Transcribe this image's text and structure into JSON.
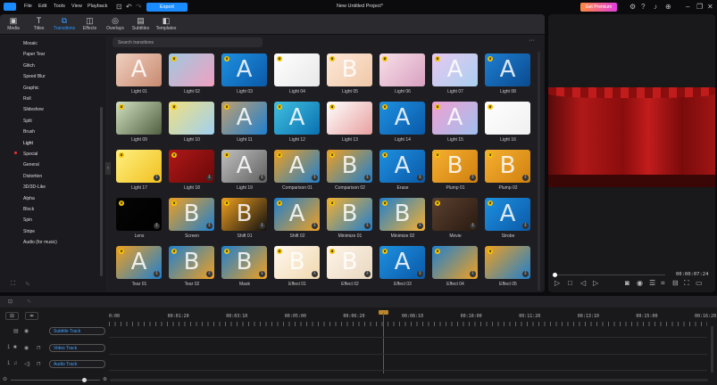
{
  "titlebar": {
    "menu": [
      "File",
      "Edit",
      "Tools",
      "View",
      "Playback"
    ],
    "export": "Export",
    "project_title": "New Untitled Project*",
    "premium": "Get Premium"
  },
  "tabs": [
    {
      "label": "Media",
      "icon": "▣"
    },
    {
      "label": "Titles",
      "icon": "T"
    },
    {
      "label": "Transitions",
      "icon": "⧉"
    },
    {
      "label": "Effects",
      "icon": "◫"
    },
    {
      "label": "Overlays",
      "icon": "◎"
    },
    {
      "label": "Subtitles",
      "icon": "▤"
    },
    {
      "label": "Templates",
      "icon": "◧"
    }
  ],
  "active_tab": "Transitions",
  "categories": [
    "Mosaic",
    "Paper Tear",
    "Glitch",
    "Speed Blur",
    "Graphic",
    "Roll",
    "Slideshow",
    "Split",
    "Brush",
    "Light",
    "Special",
    "General",
    "Distortion",
    "3D/3D-Like",
    "Alpha",
    "Block",
    "Spin",
    "Stripe",
    "Audio (for music)"
  ],
  "active_category": "Light",
  "search": {
    "placeholder": "Search transitions"
  },
  "transitions": [
    {
      "name": "Light 01",
      "letter": "A",
      "c": [
        "#f0d0c0",
        "#c88a70"
      ]
    },
    {
      "name": "Light 02",
      "letter": "",
      "c": [
        "#a0c8e0",
        "#f0a0c0"
      ]
    },
    {
      "name": "Light 03",
      "letter": "A",
      "c": [
        "#1e90e0",
        "#0a5aa8"
      ]
    },
    {
      "name": "Light 04",
      "letter": "",
      "c": [
        "#ffffff",
        "#e8e8e8"
      ]
    },
    {
      "name": "Light 05",
      "letter": "B",
      "c": [
        "#fde8d8",
        "#f0c8a8"
      ]
    },
    {
      "name": "Light 06",
      "letter": "",
      "c": [
        "#f8e0e8",
        "#d8a0c0"
      ]
    },
    {
      "name": "Light 07",
      "letter": "A",
      "c": [
        "#e8c8f0",
        "#a8d0f0"
      ]
    },
    {
      "name": "Light 08",
      "letter": "A",
      "c": [
        "#1e7fd0",
        "#0a4a90"
      ]
    },
    {
      "name": "Light 09",
      "letter": "",
      "c": [
        "#d0e0c0",
        "#506040"
      ]
    },
    {
      "name": "Light 10",
      "letter": "",
      "c": [
        "#f0e080",
        "#a0d0f0"
      ]
    },
    {
      "name": "Light 11",
      "letter": "A",
      "c": [
        "#c0a070",
        "#1e7fd0"
      ]
    },
    {
      "name": "Light 12",
      "letter": "A",
      "c": [
        "#40c0e0",
        "#0a70b0"
      ]
    },
    {
      "name": "Light 13",
      "letter": "",
      "c": [
        "#ffffff",
        "#e8a0a0"
      ]
    },
    {
      "name": "Light 14",
      "letter": "A",
      "c": [
        "#1e90e0",
        "#0a5aa8"
      ]
    },
    {
      "name": "Light 15",
      "letter": "A",
      "c": [
        "#f0a0d0",
        "#a0c0f0"
      ]
    },
    {
      "name": "Light 16",
      "letter": "",
      "c": [
        "#ffffff",
        "#f0f0f0"
      ]
    },
    {
      "name": "Light 17",
      "letter": "",
      "c": [
        "#fff080",
        "#f0c020"
      ]
    },
    {
      "name": "Light 18",
      "letter": "",
      "c": [
        "#b01818",
        "#6a0808"
      ]
    },
    {
      "name": "Light 19",
      "letter": "A",
      "c": [
        "#c0c0c0",
        "#606060"
      ]
    },
    {
      "name": "Comparison 01",
      "letter": "A",
      "c": [
        "#f0a020",
        "#1e7fd0"
      ]
    },
    {
      "name": "Comparison 02",
      "letter": "B",
      "c": [
        "#f0a020",
        "#1e7fd0"
      ]
    },
    {
      "name": "Erase",
      "letter": "A",
      "c": [
        "#1e90e0",
        "#0a5aa8"
      ]
    },
    {
      "name": "Plump 01",
      "letter": "B",
      "c": [
        "#f5b030",
        "#d08010"
      ]
    },
    {
      "name": "Plump 02",
      "letter": "B",
      "c": [
        "#f5b030",
        "#d08010"
      ]
    },
    {
      "name": "Lens",
      "letter": "",
      "c": [
        "#050505",
        "#000000"
      ]
    },
    {
      "name": "Screen",
      "letter": "B",
      "c": [
        "#f0a020",
        "#1e7fd0"
      ]
    },
    {
      "name": "Shift 01",
      "letter": "B",
      "c": [
        "#f0a020",
        "#101010"
      ]
    },
    {
      "name": "Shift 02",
      "letter": "A",
      "c": [
        "#1e7fd0",
        "#f0a020"
      ]
    },
    {
      "name": "Minimize 01",
      "letter": "B",
      "c": [
        "#f5b030",
        "#1e7fd0"
      ]
    },
    {
      "name": "Minimize 02",
      "letter": "B",
      "c": [
        "#1e7fd0",
        "#f5b030"
      ]
    },
    {
      "name": "Movie",
      "letter": "",
      "c": [
        "#5a4030",
        "#2a1a10"
      ]
    },
    {
      "name": "Strobe",
      "letter": "A",
      "c": [
        "#1e90e0",
        "#0a5aa8"
      ]
    },
    {
      "name": "Tear 01",
      "letter": "A",
      "c": [
        "#f0a020",
        "#1e7fd0"
      ]
    },
    {
      "name": "Tear 02",
      "letter": "B",
      "c": [
        "#1e7fd0",
        "#f0a020"
      ]
    },
    {
      "name": "Mask",
      "letter": "B",
      "c": [
        "#1e7fd0",
        "#f0a020"
      ]
    },
    {
      "name": "Effect 01",
      "letter": "B",
      "c": [
        "#fff8ee",
        "#f0d8b0"
      ]
    },
    {
      "name": "Effect 02",
      "letter": "B",
      "c": [
        "#fff4e8",
        "#e8d8c0"
      ]
    },
    {
      "name": "Effect 03",
      "letter": "A",
      "c": [
        "#1e90e0",
        "#0a5aa8"
      ]
    },
    {
      "name": "Effect 04",
      "letter": "",
      "c": [
        "#1e7fd0",
        "#f0a020"
      ]
    },
    {
      "name": "Effect 05",
      "letter": "",
      "c": [
        "#f0a020",
        "#1e7fd0"
      ]
    }
  ],
  "preview": {
    "timecode": "00:00:07:24",
    "progress": 0.0
  },
  "timeline": {
    "ruler": [
      "0:00",
      "00:01:20",
      "00:03:10",
      "00:05:00",
      "00:06:20",
      "00:08:10",
      "00:10:00",
      "00:11:20",
      "00:13:10",
      "00:15:00",
      "00:16:20"
    ],
    "tracks": [
      {
        "label": "Subtitle Track",
        "num": ""
      },
      {
        "label": "Video Track",
        "num": "1"
      },
      {
        "label": "Audio Track",
        "num": "1"
      }
    ]
  }
}
